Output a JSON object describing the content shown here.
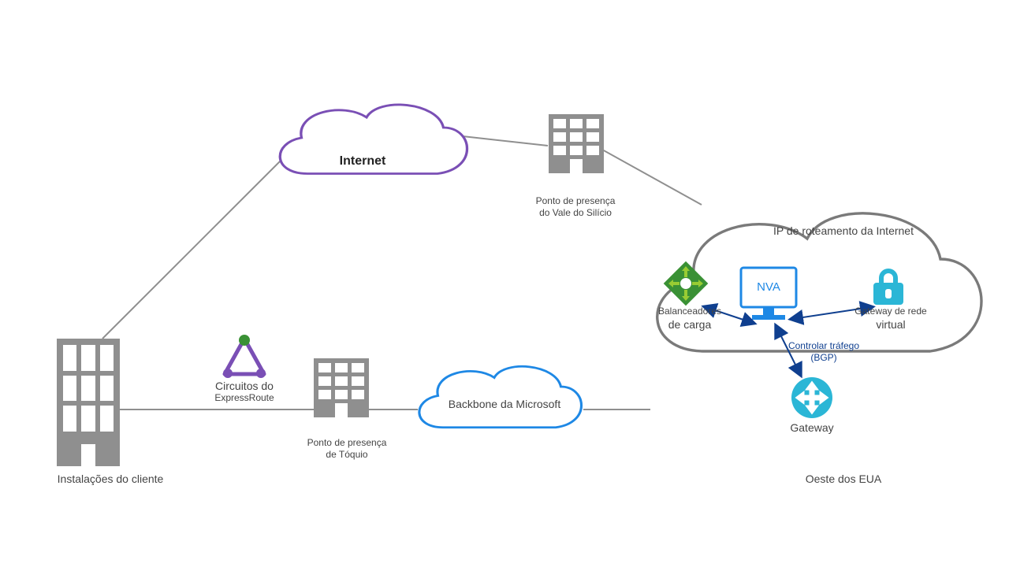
{
  "labels": {
    "customer_premises": "Instalações do cliente",
    "internet": "Internet",
    "expressroute_l1": "Circuitos do",
    "expressroute_l2": "ExpressRoute",
    "pop_tokyo_l1": "Ponto de presença",
    "pop_tokyo_l2": "de Tóquio",
    "pop_sv_l1": "Ponto de presença",
    "pop_sv_l2": "do Vale do Silício",
    "ms_backbone": "Backbone da Microsoft",
    "big_cloud_title": "IP de roteamento da Internet",
    "lb_l1": "Balanceadores",
    "lb_l2": "de carga",
    "nva": "NVA",
    "vng_l1": "Gateway de rede",
    "vng_l2": "virtual",
    "ctrl_l1": "Controlar tráfego",
    "ctrl_l2": "(BGP)",
    "gateway": "Gateway",
    "region": "Oeste dos EUA"
  },
  "colors": {
    "gray": "#8f8f8f",
    "purple": "#7a4fb5",
    "blue": "#1e88e5",
    "dkblue": "#0f3f8f",
    "green": "#3a9135",
    "lime": "#99cc33",
    "cyan": "#2bb6d6",
    "text": "#444"
  }
}
